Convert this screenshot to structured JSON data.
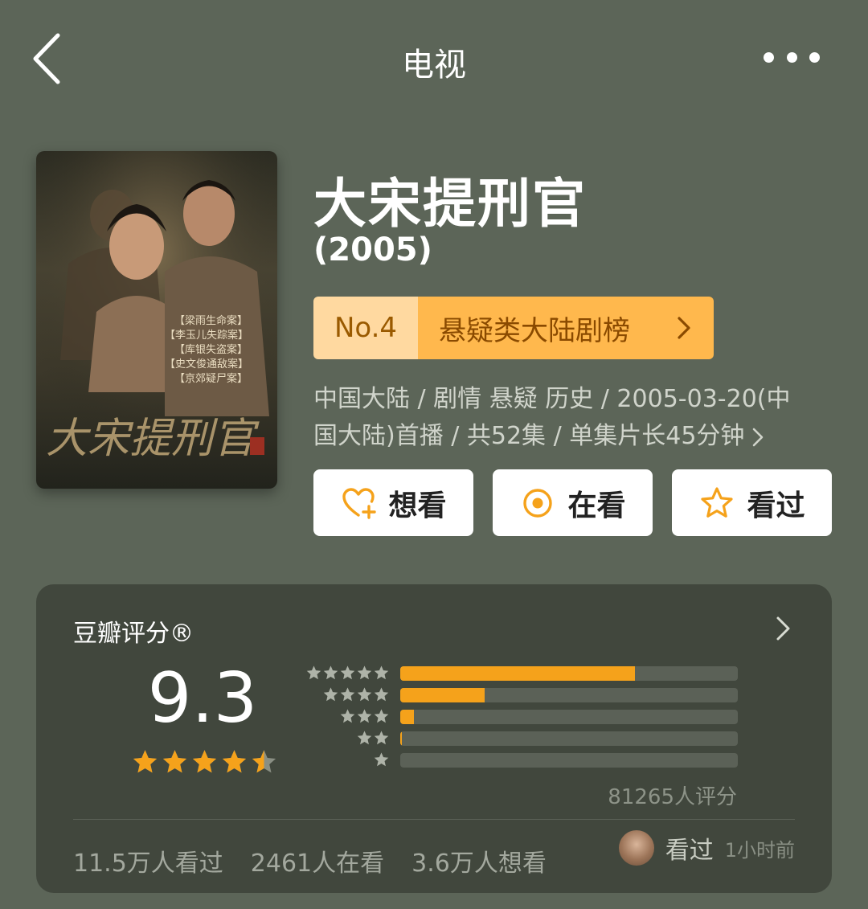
{
  "nav": {
    "title": "电视"
  },
  "poster": {
    "cases": [
      "【梁雨生命案】",
      "【李玉儿失踪案】",
      "【库银失盗案】",
      "【史文俊通敌案】",
      "【京郊疑尸案】"
    ],
    "calligraphy": "大宋提刑官"
  },
  "show": {
    "title": "大宋提刑官",
    "year": "(2005)",
    "rank_no": "No.4",
    "rank_name": "悬疑类大陆剧榜",
    "meta_line1": "中国大陆 / 剧情 悬疑 历史 / 2005-03-20(中",
    "meta_line2": "国大陆)首播 / 共52集 / 单集片长45分钟"
  },
  "actions": [
    {
      "label": "想看",
      "icon": "heart-plus-icon"
    },
    {
      "label": "在看",
      "icon": "target-circle-icon"
    },
    {
      "label": "看过",
      "icon": "star-outline-icon"
    }
  ],
  "rating": {
    "title": "豆瓣评分®",
    "score": "9.3",
    "stars": 4.5,
    "distribution": [
      {
        "stars": 5,
        "fraction": 0.695
      },
      {
        "stars": 4,
        "fraction": 0.25
      },
      {
        "stars": 3,
        "fraction": 0.04
      },
      {
        "stars": 2,
        "fraction": 0.005
      },
      {
        "stars": 1,
        "fraction": 0.0
      }
    ],
    "raters": "81265人评分"
  },
  "stats": {
    "watched": "11.5万人看过",
    "watching": "2461人在看",
    "want": "3.6万人想看"
  },
  "recent": {
    "status": "看过",
    "time": "1小时前"
  },
  "colors": {
    "accent": "#f5a21b",
    "background": "#5c6558",
    "card": "#41473d"
  }
}
